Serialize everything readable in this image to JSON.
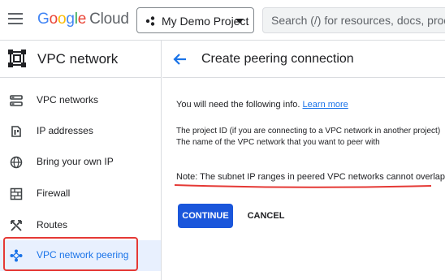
{
  "header": {
    "logo": {
      "G": "G",
      "o1": "o",
      "o2": "o",
      "g": "g",
      "l": "l",
      "e": "e",
      "cloud": "Cloud"
    },
    "project_label": "My Demo Project",
    "search_placeholder": "Search (/) for resources, docs, products"
  },
  "sidebar": {
    "title": "VPC network",
    "items": [
      {
        "label": "VPC networks",
        "icon": "vpc-networks-icon"
      },
      {
        "label": "IP addresses",
        "icon": "ip-addresses-icon"
      },
      {
        "label": "Bring your own IP",
        "icon": "globe-icon"
      },
      {
        "label": "Firewall",
        "icon": "firewall-icon"
      },
      {
        "label": "Routes",
        "icon": "routes-icon"
      },
      {
        "label": "VPC network peering",
        "icon": "peering-icon"
      }
    ],
    "active_index": 5
  },
  "main": {
    "title": "Create peering connection",
    "info_text": "You will need the following info.",
    "learn_more": "Learn more",
    "requirements": [
      "The project ID (if you are connecting to a VPC network in another project)",
      "The name of the VPC network that you want to peer with"
    ],
    "note": "Note: The subnet IP ranges in peered VPC networks cannot overlap.",
    "continue_label": "CONTINUE",
    "cancel_label": "CANCEL"
  },
  "colors": {
    "accent": "#1a73e8",
    "primary_button": "#1a56db",
    "highlight_red": "#e53935",
    "active_bg": "#e8f0fe"
  }
}
